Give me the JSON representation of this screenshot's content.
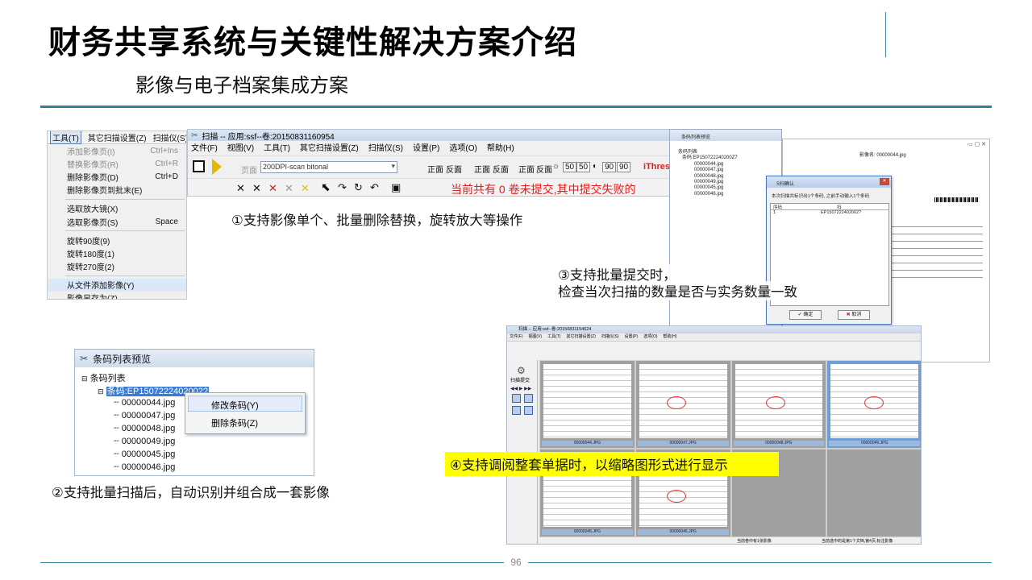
{
  "slide": {
    "title": "财务共享系统与关键性解决方案介绍",
    "subtitle": "影像与电子档案集成方案",
    "page_number": "96"
  },
  "tools_menu": {
    "bar": [
      "工具(T)",
      "其它扫描设置(Z)",
      "扫描仪(S)",
      "设"
    ],
    "items": [
      {
        "label": "添加影像页(I)",
        "shortcut": "Ctrl+Ins",
        "disabled": true
      },
      {
        "label": "替换影像页(R)",
        "shortcut": "Ctrl+R",
        "disabled": true
      },
      {
        "label": "删除影像页(D)",
        "shortcut": "Ctrl+D",
        "disabled": false
      },
      {
        "label": "删除影像页到批末(E)",
        "shortcut": "",
        "disabled": false
      },
      {
        "sep": true
      },
      {
        "label": "选取放大镜(X)",
        "shortcut": "",
        "disabled": false
      },
      {
        "label": "选取影像页(S)",
        "shortcut": "Space",
        "disabled": false
      },
      {
        "sep": true
      },
      {
        "label": "旋转90度(9)",
        "shortcut": "",
        "disabled": false
      },
      {
        "label": "旋转180度(1)",
        "shortcut": "",
        "disabled": false
      },
      {
        "label": "旋转270度(2)",
        "shortcut": "",
        "disabled": false
      },
      {
        "sep": true
      },
      {
        "label": "从文件添加影像(Y)",
        "shortcut": "",
        "disabled": false,
        "highlight": true
      },
      {
        "label": "影像另存为(Z)",
        "shortcut": "",
        "disabled": false
      }
    ]
  },
  "scan_window": {
    "title": "扫描 -- 应用:ssf--卷:20150831160954",
    "menu": [
      "文件(F)",
      "视图(V)",
      "工具(T)",
      "其它扫描设置(Z)",
      "扫描仪(S)",
      "设置(P)",
      "选项(O)",
      "帮助(H)"
    ],
    "page_label": "页面",
    "scan_mode": "200DPI-scan bitonal",
    "face_front": "正面",
    "face_back": "反面",
    "brightness": "50",
    "contrast": "50",
    "dpi": "90",
    "thresh": "iThres",
    "status": "当前共有 0 卷未提交,其中提交失败的"
  },
  "captions": {
    "c1": "①支持影像单个、批量删除替换，旋转放大等操作",
    "c2": "②支持批量扫描后，自动识别并组合成一套影像",
    "c3_line1": "③支持批量提交时，",
    "c3_line2": "检查当次扫描的数量是否与实务数量一致",
    "c4": "④支持调阅整套单据时，以缩略图形式进行显示"
  },
  "barcode_panel": {
    "title": "条码列表预览",
    "root": "条码列表",
    "code": "条码:EP1507222402002?",
    "files": [
      "00000044.jpg",
      "00000047.jpg",
      "00000048.jpg",
      "00000049.jpg",
      "00000045.jpg",
      "00000046.jpg"
    ],
    "context_menu": [
      "修改条码(Y)",
      "删除条码(Z)"
    ]
  },
  "submit_shot": {
    "preview_title": "条码列表预览",
    "tree_root": "条码列表",
    "tree_code": "条码:EP150722240200Z7",
    "files": [
      "00000044.jpg",
      "00000047.jpg",
      "00000048.jpg",
      "00000049.jpg",
      "00000045.jpg",
      "00000046.jpg"
    ],
    "image_name": "影像名: 00000044.jpg",
    "ok": "确定",
    "cancel": "取消",
    "dialog_title": "S扫确认",
    "dialog_msg": "本次扫描共标识出1个条码, 之前手动输入1个条码",
    "col_no": "序码",
    "col_code": "扫",
    "row_no": "1",
    "row_code": "EP1507222402002?"
  },
  "thumb_shot": {
    "title": "扫描 -- 应用:ssf--卷:20150831154624",
    "menu": [
      "文件(F)",
      "视图(V)",
      "工具(T)",
      "其它扫描设置(Z)",
      "扫描仪(S)",
      "设置(P)",
      "选项(O)",
      "帮助(H)"
    ],
    "side_label": "扫描提交",
    "labels_row1": [
      "00000044.JPG",
      "00000047.JPG",
      "00000048.JPG",
      "00000049.JPG"
    ],
    "labels_row2": [
      "00000045.JPG",
      "00000046.JPG"
    ],
    "status1": "当前卷中有1张影像",
    "status2": "当前选中的是第1个文档,第4页,标注影像"
  }
}
